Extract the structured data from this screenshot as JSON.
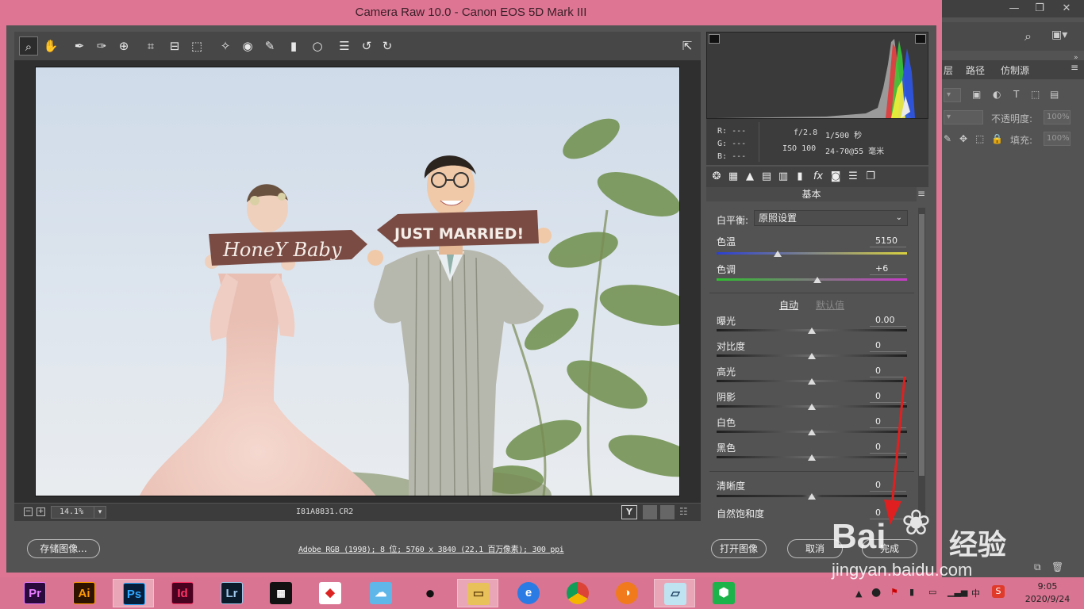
{
  "window": {
    "title": "Camera Raw 10.0 -  Canon EOS 5D Mark III"
  },
  "preview": {
    "zoom": "14.1%",
    "filename": "I81A8831.CR2",
    "sign_left": "HoneY Baby",
    "sign_right": "JUST MARRIED!"
  },
  "histogram": {
    "rgb": {
      "r_label": "R:",
      "g_label": "G:",
      "b_label": "B:",
      "r": "---",
      "g": "---",
      "b": "---"
    },
    "exif": {
      "aperture": "f/2.8",
      "shutter": "1/500 秒",
      "iso": "ISO 100",
      "lens": "24-70@55 毫米"
    }
  },
  "panel": {
    "title": "基本",
    "white_balance_label": "白平衡:",
    "white_balance_value": "原照设置",
    "temp_label": "色温",
    "temp_value": "5150",
    "temp_pos": 0.32,
    "tint_label": "色调",
    "tint_value": "+6",
    "tint_pos": 0.53,
    "auto_label": "自动",
    "default_label": "默认值",
    "sliders": [
      {
        "label": "曝光",
        "value": "0.00",
        "pos": 0.5
      },
      {
        "label": "对比度",
        "value": "0",
        "pos": 0.5
      },
      {
        "label": "高光",
        "value": "0",
        "pos": 0.5
      },
      {
        "label": "阴影",
        "value": "0",
        "pos": 0.5
      },
      {
        "label": "白色",
        "value": "0",
        "pos": 0.5
      },
      {
        "label": "黑色",
        "value": "0",
        "pos": 0.5
      }
    ],
    "clarity_label": "清晰度",
    "clarity_value": "0",
    "clarity_pos": 0.5,
    "vibrance_label": "自然饱和度",
    "vibrance_value": "0"
  },
  "bottom": {
    "save_label": "存储图像...",
    "workflow": "Adobe RGB (1998); 8 位; 5760 x 3840 (22.1 百万像素); 300 ppi",
    "open_label": "打开图像",
    "cancel_label": "取消",
    "done_label": "完成"
  },
  "photoshop": {
    "tabs": [
      "层",
      "路径",
      "仿制源"
    ],
    "opacity_label": "不透明度:",
    "opacity_value": "100%",
    "fill_label": "填充:",
    "fill_value": "100%"
  },
  "taskbar": {
    "apps": [
      {
        "name": "premiere",
        "label": "Pr",
        "bg": "#2a0a3c",
        "fg": "#e77bff"
      },
      {
        "name": "illustrator",
        "label": "Ai",
        "bg": "#2e1300",
        "fg": "#ff9a00"
      },
      {
        "name": "photoshop",
        "label": "Ps",
        "bg": "#061e3a",
        "fg": "#31a8ff"
      },
      {
        "name": "indesign",
        "label": "Id",
        "bg": "#49021f",
        "fg": "#ff3366"
      },
      {
        "name": "lightroom",
        "label": "Lr",
        "bg": "#0a1b2c",
        "fg": "#9fc7ea"
      }
    ],
    "clock_time": "9:05",
    "clock_date": "2020/9/24",
    "ime": "中"
  },
  "watermark": {
    "brand": "Bai",
    "brand_cn": "经验",
    "url": "jingyan.baidu.com"
  },
  "colors": {
    "window_frame": "#dd7593",
    "panel_bg": "#535353",
    "accent_arrow": "#e02020"
  }
}
